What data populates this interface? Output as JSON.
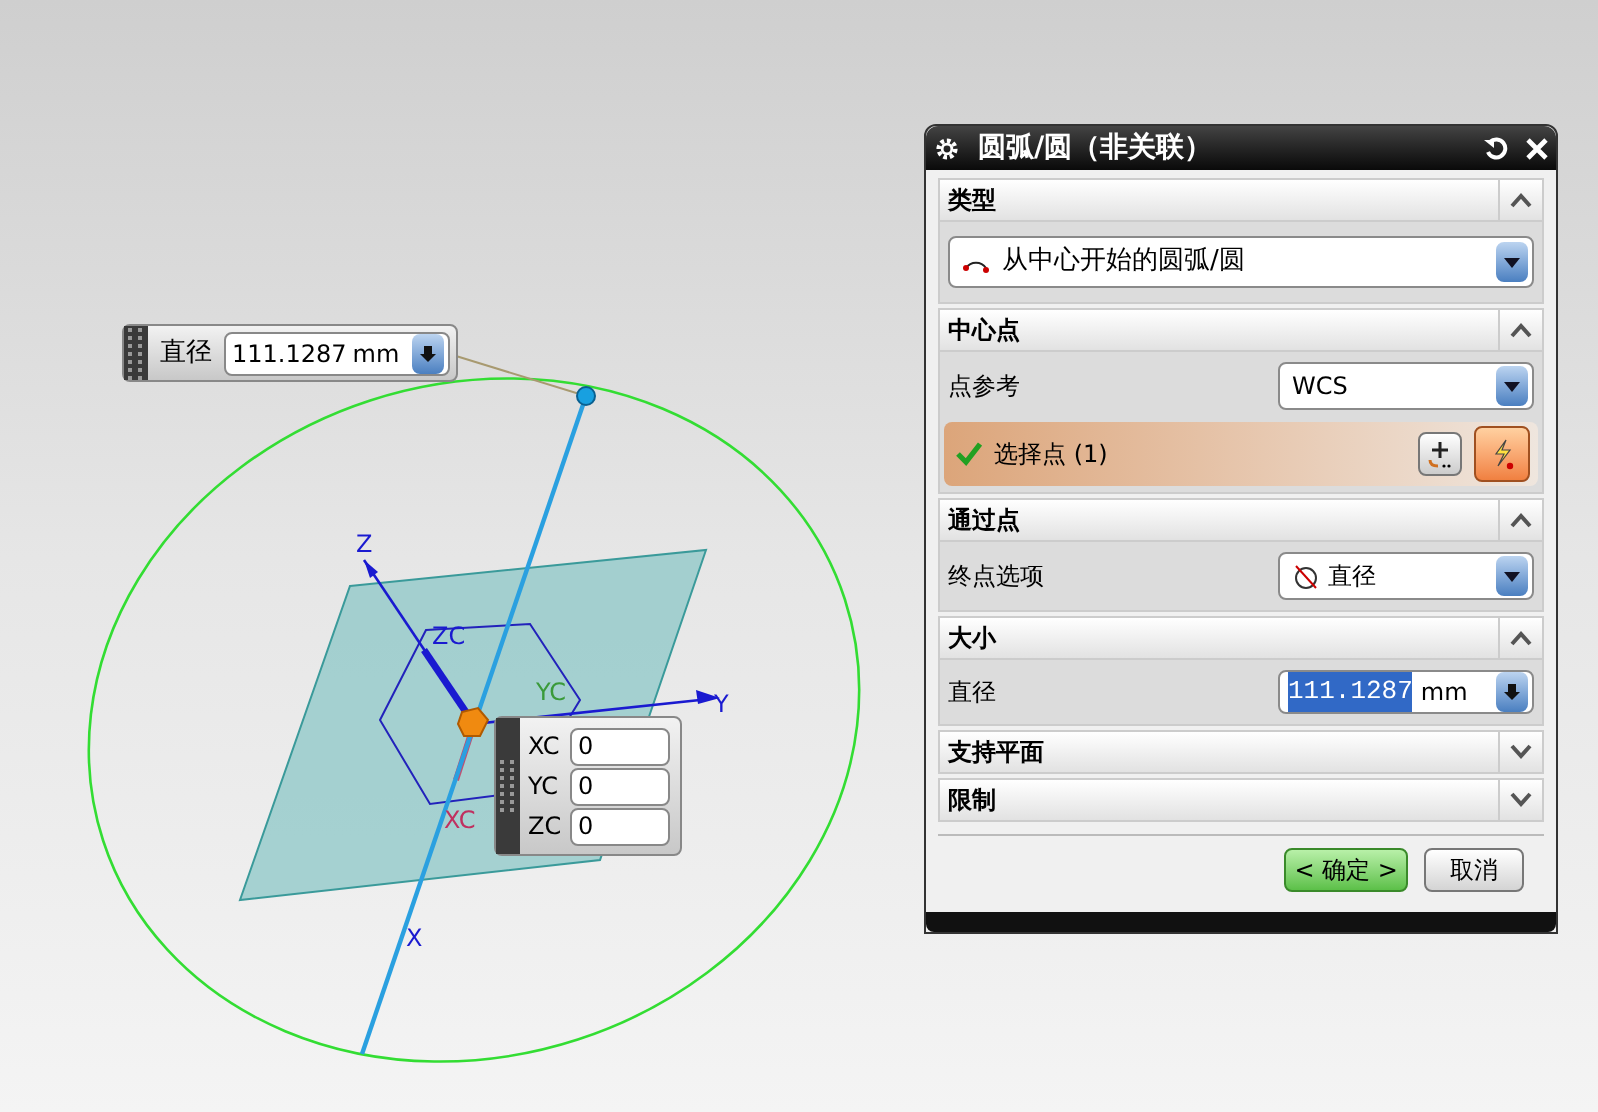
{
  "canvas": {
    "axis_labels": [
      {
        "text": "Z",
        "color": "#1a1ad0"
      },
      {
        "text": "Y",
        "color": "#1a1ad0"
      },
      {
        "text": "X",
        "color": "#1a1ad0"
      },
      {
        "text": "ZC",
        "color": "#1a1ad0"
      },
      {
        "text": "YC",
        "color": "#3a9a3a"
      },
      {
        "text": "XC",
        "color": "#c03060"
      }
    ]
  },
  "diameter_widget": {
    "label": "直径",
    "value": "111.1287",
    "unit": "mm"
  },
  "coordinate_widget": {
    "fields": [
      {
        "label": "XC",
        "value": "0"
      },
      {
        "label": "YC",
        "value": "0"
      },
      {
        "label": "ZC",
        "value": "0"
      }
    ]
  },
  "dialog": {
    "title": "圆弧/圆（非关联）",
    "sections": [
      {
        "title": "类型",
        "expanded": true,
        "rows": [
          {
            "kind": "type_dropdown",
            "value": "从中心开始的圆弧/圆"
          }
        ]
      },
      {
        "title": "中心点",
        "expanded": true,
        "rows": [
          {
            "kind": "dropdown",
            "label": "点参考",
            "value": "WCS"
          },
          {
            "kind": "select",
            "label": "选择点 (1)",
            "checked": true
          }
        ]
      },
      {
        "title": "通过点",
        "expanded": true,
        "rows": [
          {
            "kind": "icon_dropdown",
            "label": "终点选项",
            "value": "直径"
          }
        ]
      },
      {
        "title": "大小",
        "expanded": true,
        "rows": [
          {
            "kind": "number",
            "label": "直径",
            "value": "111.1287",
            "unit": "mm",
            "highlighted": true
          }
        ]
      },
      {
        "title": "支持平面",
        "expanded": false
      },
      {
        "title": "限制",
        "expanded": false
      }
    ],
    "buttons": [
      {
        "label": "< 确定 >",
        "kind": "primary"
      },
      {
        "label": "取消",
        "kind": "default"
      }
    ]
  }
}
